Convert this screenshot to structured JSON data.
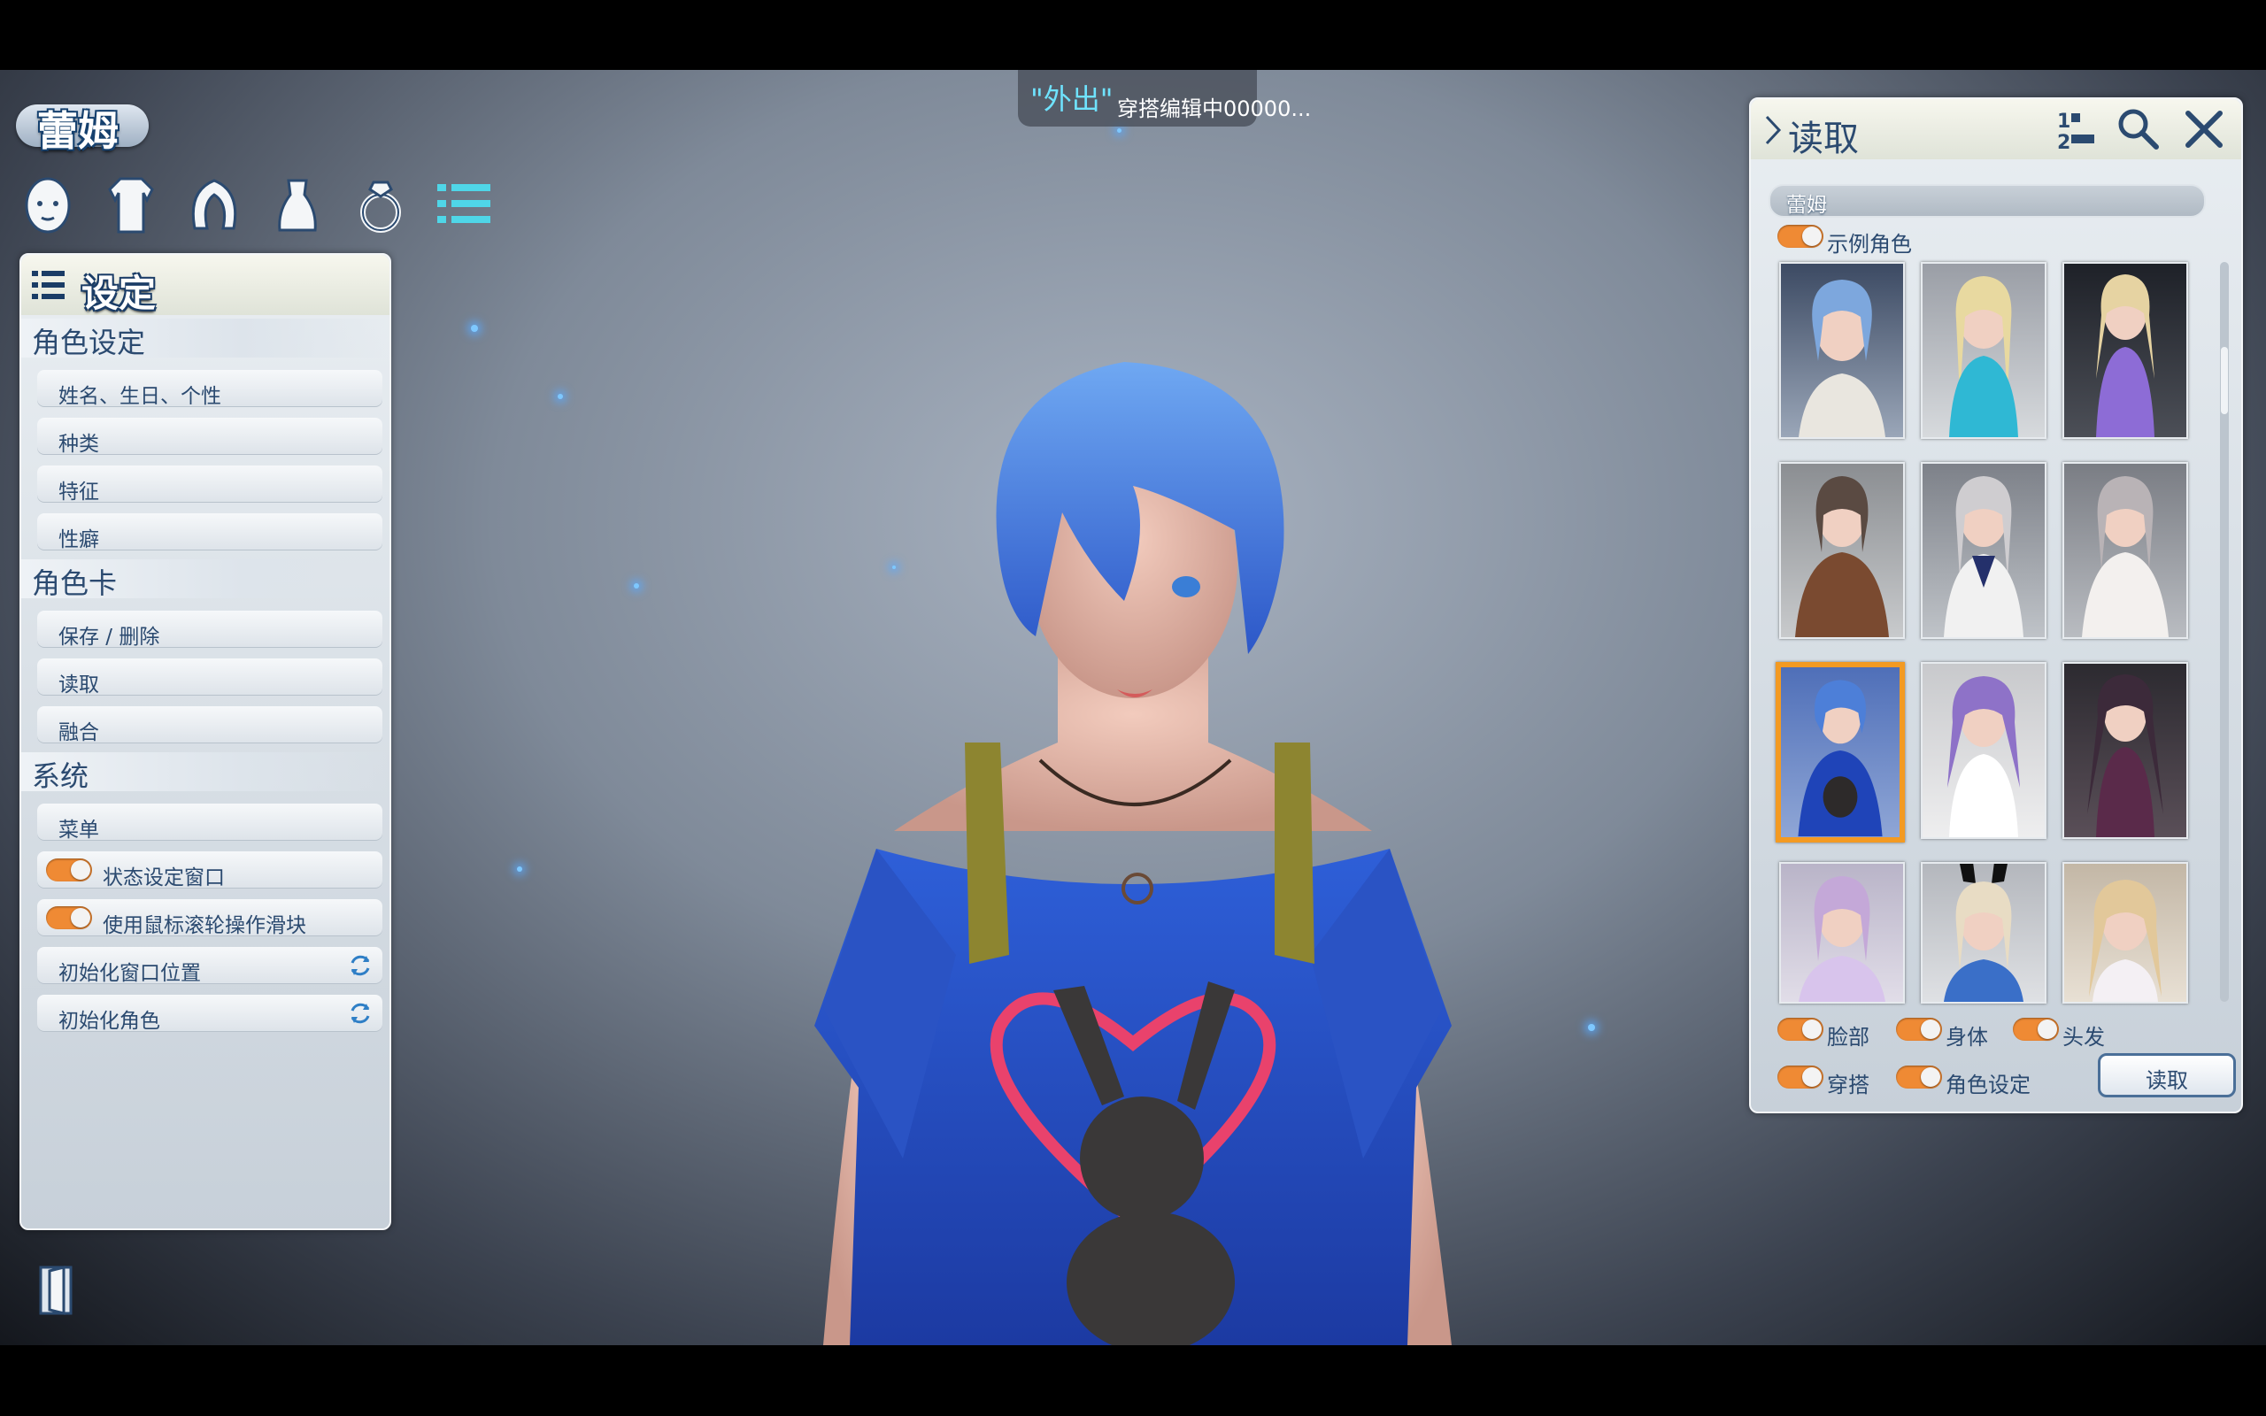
{
  "status_banner": {
    "mode": "\"外出\"",
    "message": "穿搭编辑中00000..."
  },
  "character_name": "蕾姆",
  "category_icons": [
    "face-icon",
    "body-icon",
    "hair-icon",
    "outfit-icon",
    "accessory-icon",
    "settings-list-icon"
  ],
  "left_panel": {
    "title": "设定",
    "sections": {
      "character_settings": {
        "title": "角色设定",
        "items": [
          "姓名、生日、个性",
          "种类",
          "特征",
          "性癖"
        ]
      },
      "character_card": {
        "title": "角色卡",
        "items": [
          "保存 / 删除",
          "读取",
          "融合"
        ]
      },
      "system": {
        "title": "系统",
        "items": {
          "menu": "菜单",
          "status_window": "状态设定窗口",
          "mouse_wheel": "使用鼠标滚轮操作滑块",
          "reset_window": "初始化窗口位置",
          "reset_character": "初始化角色"
        },
        "toggles": {
          "status_window": true,
          "mouse_wheel": true
        }
      }
    }
  },
  "right_panel": {
    "title": "读取",
    "search_value": "蕾姆",
    "sample_toggle": {
      "label": "示例角色",
      "on": true
    },
    "thumbnails_visible": 12,
    "selected_thumbnail": 7,
    "options": {
      "face": "脸部",
      "body": "身体",
      "hair": "头发",
      "outfit": "穿搭",
      "character_settings": "角色设定"
    },
    "load_button": "读取"
  },
  "colors": {
    "accent_orange": "#ef8a34",
    "label_blue": "#2b4a70",
    "mode_cyan": "#6fe3ff"
  }
}
